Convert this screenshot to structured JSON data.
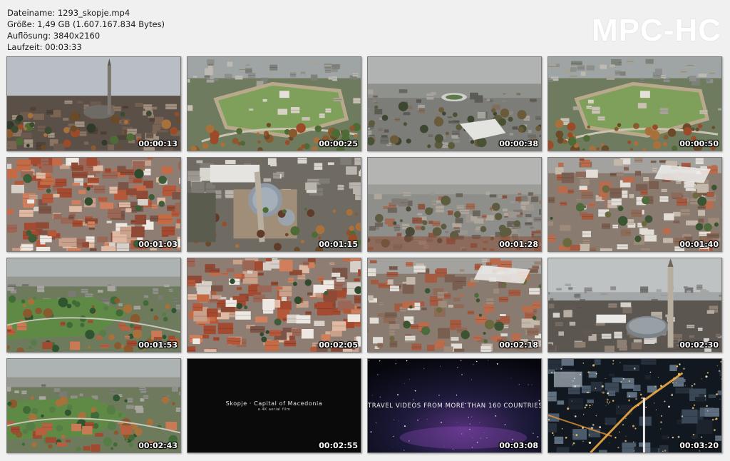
{
  "file_info": {
    "filename_line": "Dateiname: 1293_skopje.mp4",
    "size_line": "Größe: 1,49 GB (1.607.167.834 Bytes)",
    "resolution_line": "Auflösung: 3840x2160",
    "duration_line": "Laufzeit: 00:03:33"
  },
  "brand": {
    "label": "MPC-HC"
  },
  "thumbnails": [
    {
      "timestamp": "00:00:13",
      "scene": "minaret-mosque"
    },
    {
      "timestamp": "00:00:25",
      "scene": "fortress-walls"
    },
    {
      "timestamp": "00:00:38",
      "scene": "city-stadium"
    },
    {
      "timestamp": "00:00:50",
      "scene": "fortress-walls"
    },
    {
      "timestamp": "00:01:03",
      "scene": "red-roofs"
    },
    {
      "timestamp": "00:01:15",
      "scene": "mosque-dome"
    },
    {
      "timestamp": "00:01:28",
      "scene": "foggy-city"
    },
    {
      "timestamp": "00:01:40",
      "scene": "old-bazaar"
    },
    {
      "timestamp": "00:01:53",
      "scene": "green-city"
    },
    {
      "timestamp": "00:02:05",
      "scene": "red-roofs"
    },
    {
      "timestamp": "00:02:18",
      "scene": "old-bazaar"
    },
    {
      "timestamp": "00:02:30",
      "scene": "minaret-dome"
    },
    {
      "timestamp": "00:02:43",
      "scene": "green-city"
    },
    {
      "timestamp": "00:02:55",
      "scene": "title-black",
      "title": "Skopje · Capital of Macedonia",
      "subtitle": "a 4K aerial film"
    },
    {
      "timestamp": "00:03:08",
      "scene": "space-text",
      "title": "TRAVEL VIDEOS FROM MORE THAN 160 COUNTRIES"
    },
    {
      "timestamp": "00:03:20",
      "scene": "night-city"
    }
  ],
  "colors": {
    "background": "#f0f0f0",
    "text": "#1a1a1a",
    "brand": "#ffffff",
    "timestamp": "#ffffff"
  }
}
